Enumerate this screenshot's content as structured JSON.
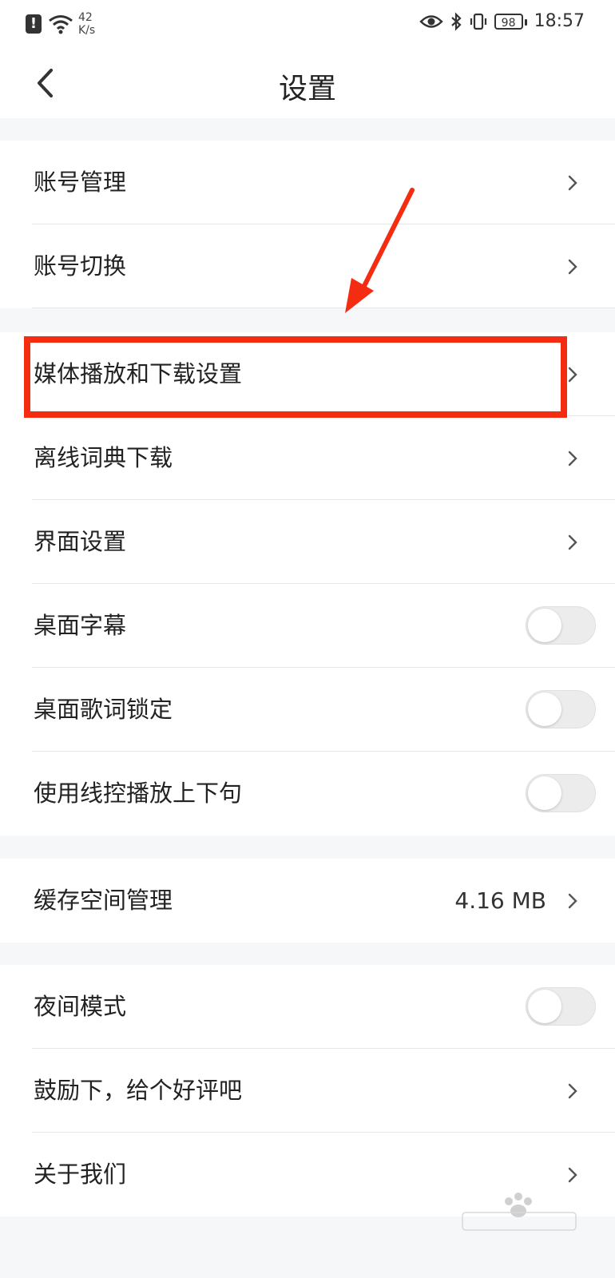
{
  "status_bar": {
    "net_speed_value": "42",
    "net_speed_unit": "K/s",
    "battery": "98",
    "time": "18:57",
    "icons": [
      "alert-icon",
      "wifi-icon",
      "eye-icon",
      "bluetooth-icon",
      "vibrate-icon",
      "battery-icon"
    ]
  },
  "nav": {
    "title": "设置",
    "back_icon": "chevron-left-icon"
  },
  "groups": [
    {
      "items": [
        {
          "label": "账号管理",
          "control": "chevron"
        },
        {
          "label": "账号切换",
          "control": "chevron"
        }
      ]
    },
    {
      "items": [
        {
          "label": "媒体播放和下载设置",
          "control": "chevron",
          "highlighted": true
        },
        {
          "label": "离线词典下载",
          "control": "chevron"
        },
        {
          "label": "界面设置",
          "control": "chevron"
        },
        {
          "label": "桌面字幕",
          "control": "toggle",
          "on": false
        },
        {
          "label": "桌面歌词锁定",
          "control": "toggle",
          "on": false
        },
        {
          "label": "使用线控播放上下句",
          "control": "toggle",
          "on": false
        }
      ]
    },
    {
      "items": [
        {
          "label": "缓存空间管理",
          "control": "chevron",
          "value": "4.16 MB"
        }
      ]
    },
    {
      "items": [
        {
          "label": "夜间模式",
          "control": "toggle",
          "on": false
        },
        {
          "label": "鼓励下，给个好评吧",
          "control": "chevron"
        },
        {
          "label": "关于我们",
          "control": "chevron"
        }
      ]
    }
  ],
  "colors": {
    "highlight": "#f42c12",
    "toggle_off": "#ececec",
    "background": "#f6f7f9"
  }
}
